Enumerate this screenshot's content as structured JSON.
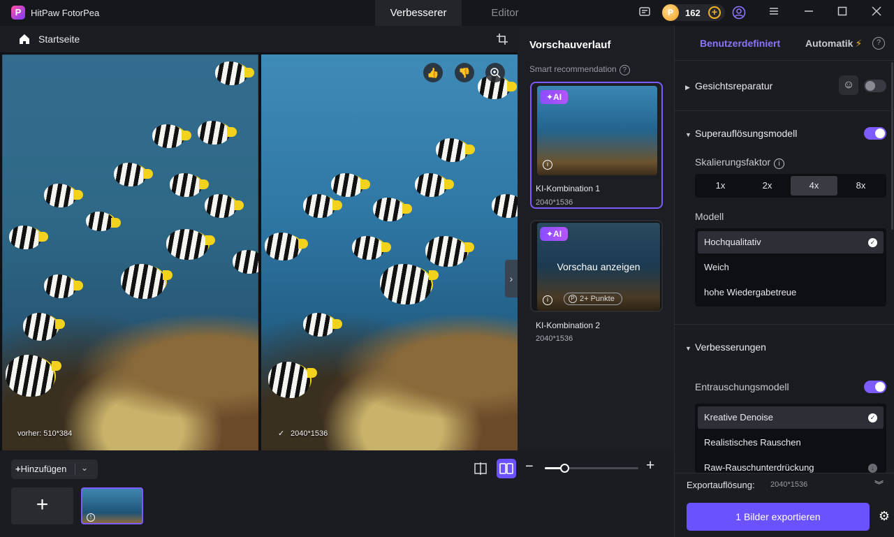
{
  "app": {
    "name": "HitPaw FotorPea",
    "logo_letter": "P"
  },
  "tabs": [
    {
      "label": "Verbesserer",
      "active": true
    },
    {
      "label": "Editor",
      "active": false
    }
  ],
  "coins": {
    "count": "162"
  },
  "workspace": {
    "home_label": "Startseite",
    "before_label": "vorher: 510*384",
    "after_label": "2040*1536"
  },
  "bottom": {
    "add_label": "Hinzufügen"
  },
  "history": {
    "title": "Vorschauverlauf",
    "smart_recommendation": "Smart recommendation",
    "cards": [
      {
        "badge": "AI",
        "name": "KI-Kombination 1",
        "size": "2040*1536"
      },
      {
        "badge": "AI",
        "name": "KI-Kombination 2",
        "size": "2040*1536",
        "overlay": "Vorschau anzeigen",
        "points": "2+ Punkte"
      }
    ]
  },
  "settings": {
    "tab_custom": "Benutzerdefiniert",
    "tab_auto": "Automatik",
    "face_repair": {
      "label": "Gesichtsreparatur",
      "enabled": false
    },
    "super_resolution": {
      "label": "Superauflösungsmodell",
      "enabled": true
    },
    "scale_factor_label": "Skalierungsfaktor",
    "scale_options": [
      "1x",
      "2x",
      "4x",
      "8x"
    ],
    "scale_selected": "4x",
    "model_label": "Modell",
    "models": [
      "Hochqualitativ",
      "Weich",
      "hohe Wiedergabetreue"
    ],
    "model_selected": "Hochqualitativ",
    "enhancements_label": "Verbesserungen",
    "denoise": {
      "label": "Entrauschungsmodell",
      "enabled": true
    },
    "denoise_models": [
      "Kreative Denoise",
      "Realistisches Rauschen",
      "Raw-Rauschunterdrückung"
    ],
    "denoise_selected": "Kreative Denoise",
    "export_res_label": "Exportauflösung:",
    "export_res_value": "2040*1536",
    "export_button": "1 Bilder exportieren"
  },
  "colors": {
    "accent": "#6a52ff",
    "accent_text": "#8c74ff",
    "background": "#1b1c20"
  }
}
